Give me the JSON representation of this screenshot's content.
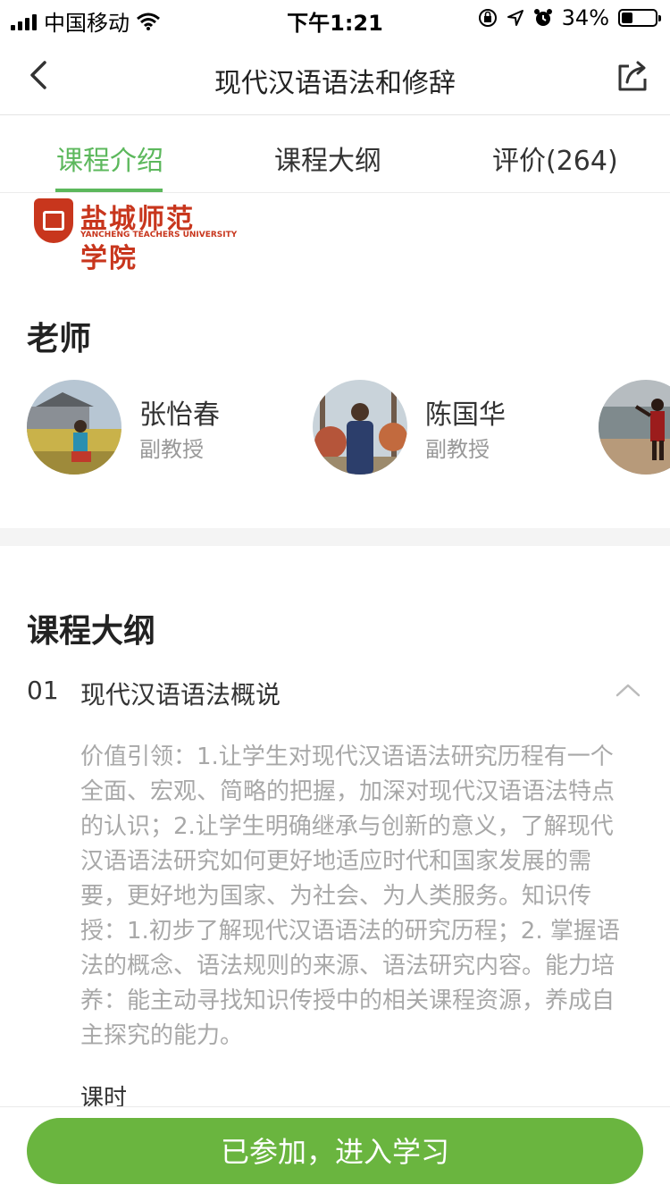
{
  "status_bar": {
    "carrier": "中国移动",
    "time": "下午1:21",
    "battery_percent": "34%",
    "battery_level": 0.34,
    "icons": [
      "signal-icon",
      "wifi-icon",
      "orientation-lock-icon",
      "location-icon",
      "alarm-icon",
      "battery-icon"
    ]
  },
  "nav": {
    "title": "现代汉语语法和修辞",
    "back_icon": "chevron-left-icon",
    "share_icon": "share-icon"
  },
  "tabs": [
    {
      "label": "课程介绍",
      "active": true
    },
    {
      "label": "课程大纲",
      "active": false
    },
    {
      "label": "评价(264)",
      "active": false
    }
  ],
  "logo": {
    "name_cn": "盐城师范学院",
    "name_en": "YANCHENG TEACHERS UNIVERSITY"
  },
  "teachers_section": {
    "title": "老师",
    "teachers": [
      {
        "name": "张怡春",
        "title": "副教授"
      },
      {
        "name": "陈国华",
        "title": "副教授"
      },
      {
        "name": "",
        "title": ""
      }
    ]
  },
  "syllabus": {
    "title": "课程大纲",
    "chapters": [
      {
        "number": "01",
        "title": "现代汉语语法概说",
        "expanded": true,
        "description": "价值引领：1.让学生对现代汉语语法研究历程有一个全面、宏观、简略的把握，加深对现代汉语语法特点的认识；2.让学生明确继承与创新的意义，了解现代汉语语法研究如何更好地适应时代和国家发展的需要，更好地为国家、为社会、为人类服务。知识传授：1.初步了解现代汉语语法的研究历程；2. 掌握语法的概念、语法规则的来源、语法研究内容。能力培养：能主动寻找知识传授中的相关课程资源，养成自主探究的能力。",
        "hours_label": "课时"
      }
    ]
  },
  "bottom": {
    "join_button": "已参加，进入学习"
  },
  "colors": {
    "accent": "#5cb85c",
    "button": "#6ab53f",
    "logo_red": "#c8361d",
    "muted_text": "#a8a8a8"
  }
}
